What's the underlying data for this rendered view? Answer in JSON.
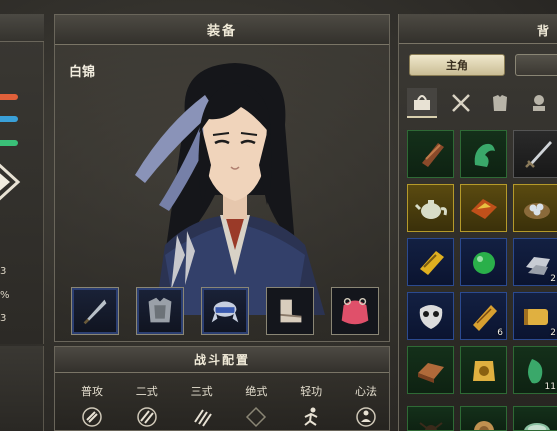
{
  "equipment_panel": {
    "title": "装备",
    "character_name": "白锦",
    "slots": [
      {
        "icon": "dagger-icon",
        "frame": "blue"
      },
      {
        "icon": "armor-icon",
        "frame": "blue"
      },
      {
        "icon": "headband-icon",
        "frame": "blue"
      },
      {
        "icon": "boots-icon",
        "frame": "plain"
      },
      {
        "icon": "pouch-icon",
        "frame": "plain"
      }
    ]
  },
  "battle_config": {
    "title": "战斗配置",
    "skills": [
      "普攻",
      "二式",
      "三式",
      "绝式",
      "轻功",
      "心法"
    ]
  },
  "left_panel": {
    "bars": [
      "#e0603a",
      "#3aa0d8",
      "#3ac078"
    ],
    "stats": [
      "3",
      "%",
      "3"
    ]
  },
  "inventory": {
    "header_title": "背",
    "tabs": {
      "main": "主角"
    },
    "categories": [
      "all-items-icon",
      "weapons-icon",
      "armor-category-icon",
      "accessories-icon"
    ],
    "items": [
      {
        "icon": "bracer-icon",
        "rarity": "green",
        "count": ""
      },
      {
        "icon": "jade-dragon-icon",
        "rarity": "green",
        "count": ""
      },
      {
        "icon": "sword-icon",
        "rarity": "gray",
        "count": ""
      },
      {
        "icon": "teapot-icon",
        "rarity": "yellow",
        "count": ""
      },
      {
        "icon": "herb-box-icon",
        "rarity": "yellow",
        "count": ""
      },
      {
        "icon": "bird-nest-icon",
        "rarity": "yellow",
        "count": ""
      },
      {
        "icon": "manual-book-icon",
        "rarity": "blue",
        "count": ""
      },
      {
        "icon": "green-orb-icon",
        "rarity": "blue",
        "count": ""
      },
      {
        "icon": "silver-ingot-icon",
        "rarity": "blue",
        "count": "2"
      },
      {
        "icon": "mask-icon",
        "rarity": "blue",
        "count": ""
      },
      {
        "icon": "scroll-icon",
        "rarity": "blue",
        "count": "6"
      },
      {
        "icon": "gold-scroll-icon",
        "rarity": "blue",
        "count": "2"
      },
      {
        "icon": "brick-icon",
        "rarity": "green",
        "count": ""
      },
      {
        "icon": "gold-token-icon",
        "rarity": "green",
        "count": ""
      },
      {
        "icon": "jade-piece-icon",
        "rarity": "green",
        "count": "11"
      },
      {
        "icon": "spider-icon",
        "rarity": "green",
        "count": ""
      },
      {
        "icon": "wood-log-icon",
        "rarity": "green",
        "count": ""
      },
      {
        "icon": "bowl-icon",
        "rarity": "green",
        "count": ""
      }
    ]
  }
}
